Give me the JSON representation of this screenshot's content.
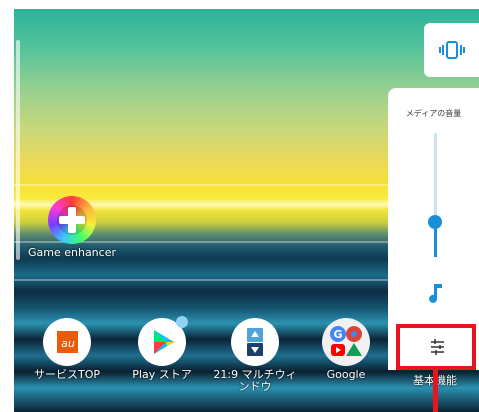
{
  "apps": [
    {
      "id": "game",
      "label": "Game enhancer",
      "icon": "game-enhancer-icon"
    },
    {
      "id": "au",
      "label": "サービスTOP",
      "icon": "au-service-icon"
    },
    {
      "id": "play",
      "label": "Play ストア",
      "icon": "play-store-icon"
    },
    {
      "id": "multi",
      "label": "21:9 マルチウィンドウ",
      "icon": "multi-window-icon"
    },
    {
      "id": "google",
      "label": "Google",
      "icon": "google-folder-icon"
    },
    {
      "id": "basic",
      "label": "基本機能",
      "icon": "basic-function-icon"
    }
  ],
  "volume_panel": {
    "title": "メディアの音量",
    "level_fraction": 0.28,
    "icons": {
      "vibrate": "vibrate-icon",
      "media": "music-note-icon",
      "settings": "sliders-icon"
    }
  },
  "colors": {
    "accent": "#1a8fd6",
    "highlight": "#e8141f"
  }
}
